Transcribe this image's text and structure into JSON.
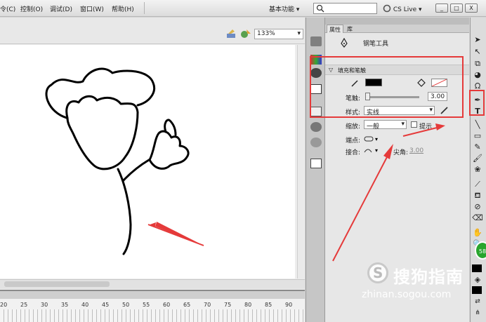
{
  "menubar": {
    "items": [
      "令(C)",
      "控制(O)",
      "调试(D)",
      "窗口(W)",
      "帮助(H)"
    ],
    "workspace": "基本功能",
    "cslive": "CS Live",
    "window_buttons": [
      "_",
      "□",
      "X"
    ]
  },
  "stage": {
    "zoom": "133%"
  },
  "timeline": {
    "frame_numbers": [
      "20",
      "25",
      "30",
      "35",
      "40",
      "45",
      "50",
      "55",
      "60",
      "65",
      "70",
      "75",
      "80",
      "85",
      "90"
    ]
  },
  "properties": {
    "tabs": [
      "属性",
      "库"
    ],
    "tool_name": "钢笔工具",
    "section_fill_stroke": "填充和笔触",
    "stroke_label": "笔触:",
    "stroke_value": "3.00",
    "style_label": "样式:",
    "style_value": "实线",
    "scale_label": "缩放:",
    "scale_value": "一般",
    "hint_label": "提示",
    "cap_label": "端点:",
    "join_label": "接合:",
    "miter_label": "尖角:",
    "miter_value": "3.00"
  },
  "colors": {
    "stroke_color": "#000000",
    "highlight": "#e53a3a",
    "arrow": "#e53a3a"
  },
  "watermark": {
    "text": "搜狗指南",
    "url": "zhinan.sogou.com",
    "badge": "58"
  }
}
